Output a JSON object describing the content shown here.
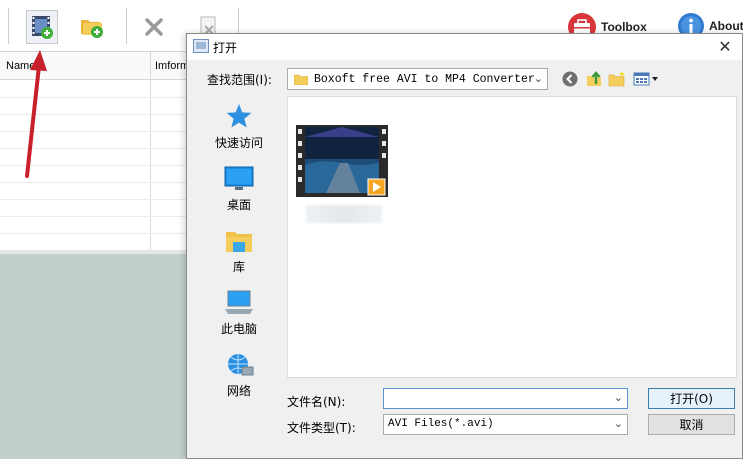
{
  "app": {
    "column_headers": {
      "name": "Name",
      "info": "Imform"
    },
    "toolbar": {
      "toolbox_label": "Toolbox",
      "about_label": "About"
    }
  },
  "dialog": {
    "title": "打开",
    "look_in_label": "查找范围(I):",
    "look_in_value": "Boxoft free AVI to MP4 Converter",
    "places": [
      "快速访问",
      "桌面",
      "库",
      "此电脑",
      "网络"
    ],
    "filename_label": "文件名(N):",
    "filename_value": "",
    "filetype_label": "文件类型(T):",
    "filetype_value": "AVI Files(*.avi)",
    "open_label": "打开(O)",
    "cancel_label": "取消",
    "close_glyph": "✕",
    "dropdown_glyph": "⌄"
  },
  "colors": {
    "accent_focus": "#5a8fd6",
    "annotation_arrow": "#c8202a",
    "bottom_pane": "#c3cfcc",
    "folder_yellow": "#f5cd5a"
  },
  "icons": {
    "toolbar": [
      "add-video-icon",
      "add-folder-icon",
      "remove-icon",
      "clear-icon",
      "toolbox-icon",
      "about-icon"
    ],
    "nav": [
      "back-icon",
      "up-folder-icon",
      "new-folder-icon",
      "view-menu-icon"
    ],
    "places": [
      "star-icon",
      "desktop-icon",
      "library-icon",
      "computer-icon",
      "network-icon"
    ]
  }
}
